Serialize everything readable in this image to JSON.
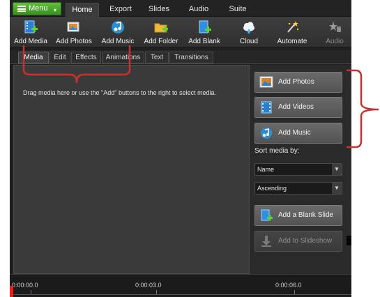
{
  "menu_button": {
    "label": "Menu",
    "caret": "▾"
  },
  "tabs": [
    {
      "label": "Home",
      "active": true
    },
    {
      "label": "Export"
    },
    {
      "label": "Slides"
    },
    {
      "label": "Audio"
    },
    {
      "label": "Suite"
    }
  ],
  "toolbar": [
    {
      "label": "Add Media",
      "icon": "add-media-icon"
    },
    {
      "label": "Add Photos",
      "icon": "add-photos-icon"
    },
    {
      "label": "Add Music",
      "icon": "add-music-icon"
    },
    {
      "label": "Add Folder",
      "icon": "add-folder-icon"
    },
    {
      "label": "Add Blank",
      "icon": "add-blank-icon"
    },
    {
      "label": "Cloud",
      "icon": "cloud-icon"
    },
    {
      "label": "Automate",
      "icon": "automate-icon"
    },
    {
      "label": "Audio",
      "icon": "audio-icon"
    }
  ],
  "subtabs": [
    {
      "label": "Media",
      "active": true
    },
    {
      "label": "Edit"
    },
    {
      "label": "Effects"
    },
    {
      "label": "Animations"
    },
    {
      "label": "Text"
    },
    {
      "label": "Transitions"
    }
  ],
  "dropzone": {
    "hint": "Drag media here or use the \"Add\" buttons to the right to select media."
  },
  "panel": {
    "add_photos": "Add Photos",
    "add_videos": "Add Videos",
    "add_music": "Add Music",
    "sort_label": "Sort media by:",
    "sort_field": "Name",
    "sort_order": "Ascending",
    "add_blank_slide": "Add a Blank Slide",
    "add_to_slideshow": "Add to Slideshow"
  },
  "timeline": {
    "marks": [
      "0:00:00.0",
      "0:00:03.0",
      "0:00:06.0"
    ]
  },
  "colors": {
    "accent_green": "#4fae2e",
    "annotation_red": "#c8322e",
    "playhead_red": "#e0231b"
  }
}
